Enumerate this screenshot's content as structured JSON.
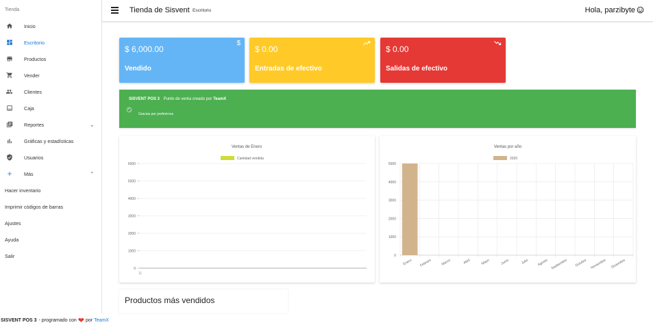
{
  "sidebar": {
    "brand": "Tienda",
    "items": [
      {
        "label": "Inicio",
        "icon": "home-icon"
      },
      {
        "label": "Escritorio",
        "icon": "dashboard-icon",
        "active": true
      },
      {
        "label": "Productos",
        "icon": "store-icon"
      },
      {
        "label": "Vender",
        "icon": "cart-icon"
      },
      {
        "label": "Clientes",
        "icon": "people-icon"
      },
      {
        "label": "Caja",
        "icon": "cash-box-icon"
      },
      {
        "label": "Reportes",
        "icon": "reports-icon"
      },
      {
        "label": "Gráficas y estadísticas",
        "icon": "bar-chart-icon"
      },
      {
        "label": "Usuarios",
        "icon": "shield-user-icon"
      },
      {
        "label": "Más",
        "icon": "plus-icon"
      }
    ],
    "extra_items": [
      "Hacer inventario",
      "Imprimir códigos de barras",
      "Ajustes",
      "Ayuda",
      "Salir"
    ],
    "accent": "#1976d2"
  },
  "topbar": {
    "title": "Tienda de Sisvent",
    "subtitle": "Escritorio",
    "greeting": "Hola, parzibyte"
  },
  "cards": [
    {
      "value": "$ 6,000.00",
      "label": "Vendido",
      "icon": "$",
      "color": "#64b5f6"
    },
    {
      "value": "$ 0.00",
      "label": "Entradas de efectivo",
      "icon": "trending-up-icon",
      "color": "#ffca28"
    },
    {
      "value": "$ 0.00",
      "label": "Salidas de efectivo",
      "icon": "trending-down-icon",
      "color": "#e53935"
    }
  ],
  "banner": {
    "brand": "SISVENT POS 3",
    "text": "Punto de venta creado por",
    "author": "TeamX",
    "subtext": "Gracias por preferirnos",
    "color": "#4caf50"
  },
  "section": {
    "title": "Productos más vendidos"
  },
  "footer": {
    "brand": "SISVENT POS 3",
    "text": "- programado con",
    "by": "por",
    "link": "TeamX"
  },
  "chart_data": [
    {
      "type": "line",
      "title": "Ventas de Enero",
      "series": [
        {
          "name": "Cantidad vendida",
          "values": [
            0
          ],
          "color": "#cddc39"
        }
      ],
      "x": [
        "11"
      ],
      "yticks": [
        0,
        1000,
        2000,
        3000,
        4000,
        5000,
        6000
      ],
      "ylim": [
        0,
        6000
      ],
      "grid": true,
      "legend": "top"
    },
    {
      "type": "bar",
      "title": "Ventas por año",
      "categories": [
        "Enero",
        "Febrero",
        "Marzo",
        "Abril",
        "Mayo",
        "Junio",
        "Julio",
        "Agosto",
        "Septiembre",
        "Octubre",
        "Noviembre",
        "Diciembre"
      ],
      "series": [
        {
          "name": "2020",
          "values": [
            5000,
            0,
            0,
            0,
            0,
            0,
            0,
            0,
            0,
            0,
            0,
            0
          ],
          "color": "#d2b48c"
        }
      ],
      "yticks": [
        0,
        1000,
        2000,
        3000,
        4000,
        5000
      ],
      "ylim": [
        0,
        5000
      ],
      "grid": true,
      "legend": "top"
    }
  ]
}
